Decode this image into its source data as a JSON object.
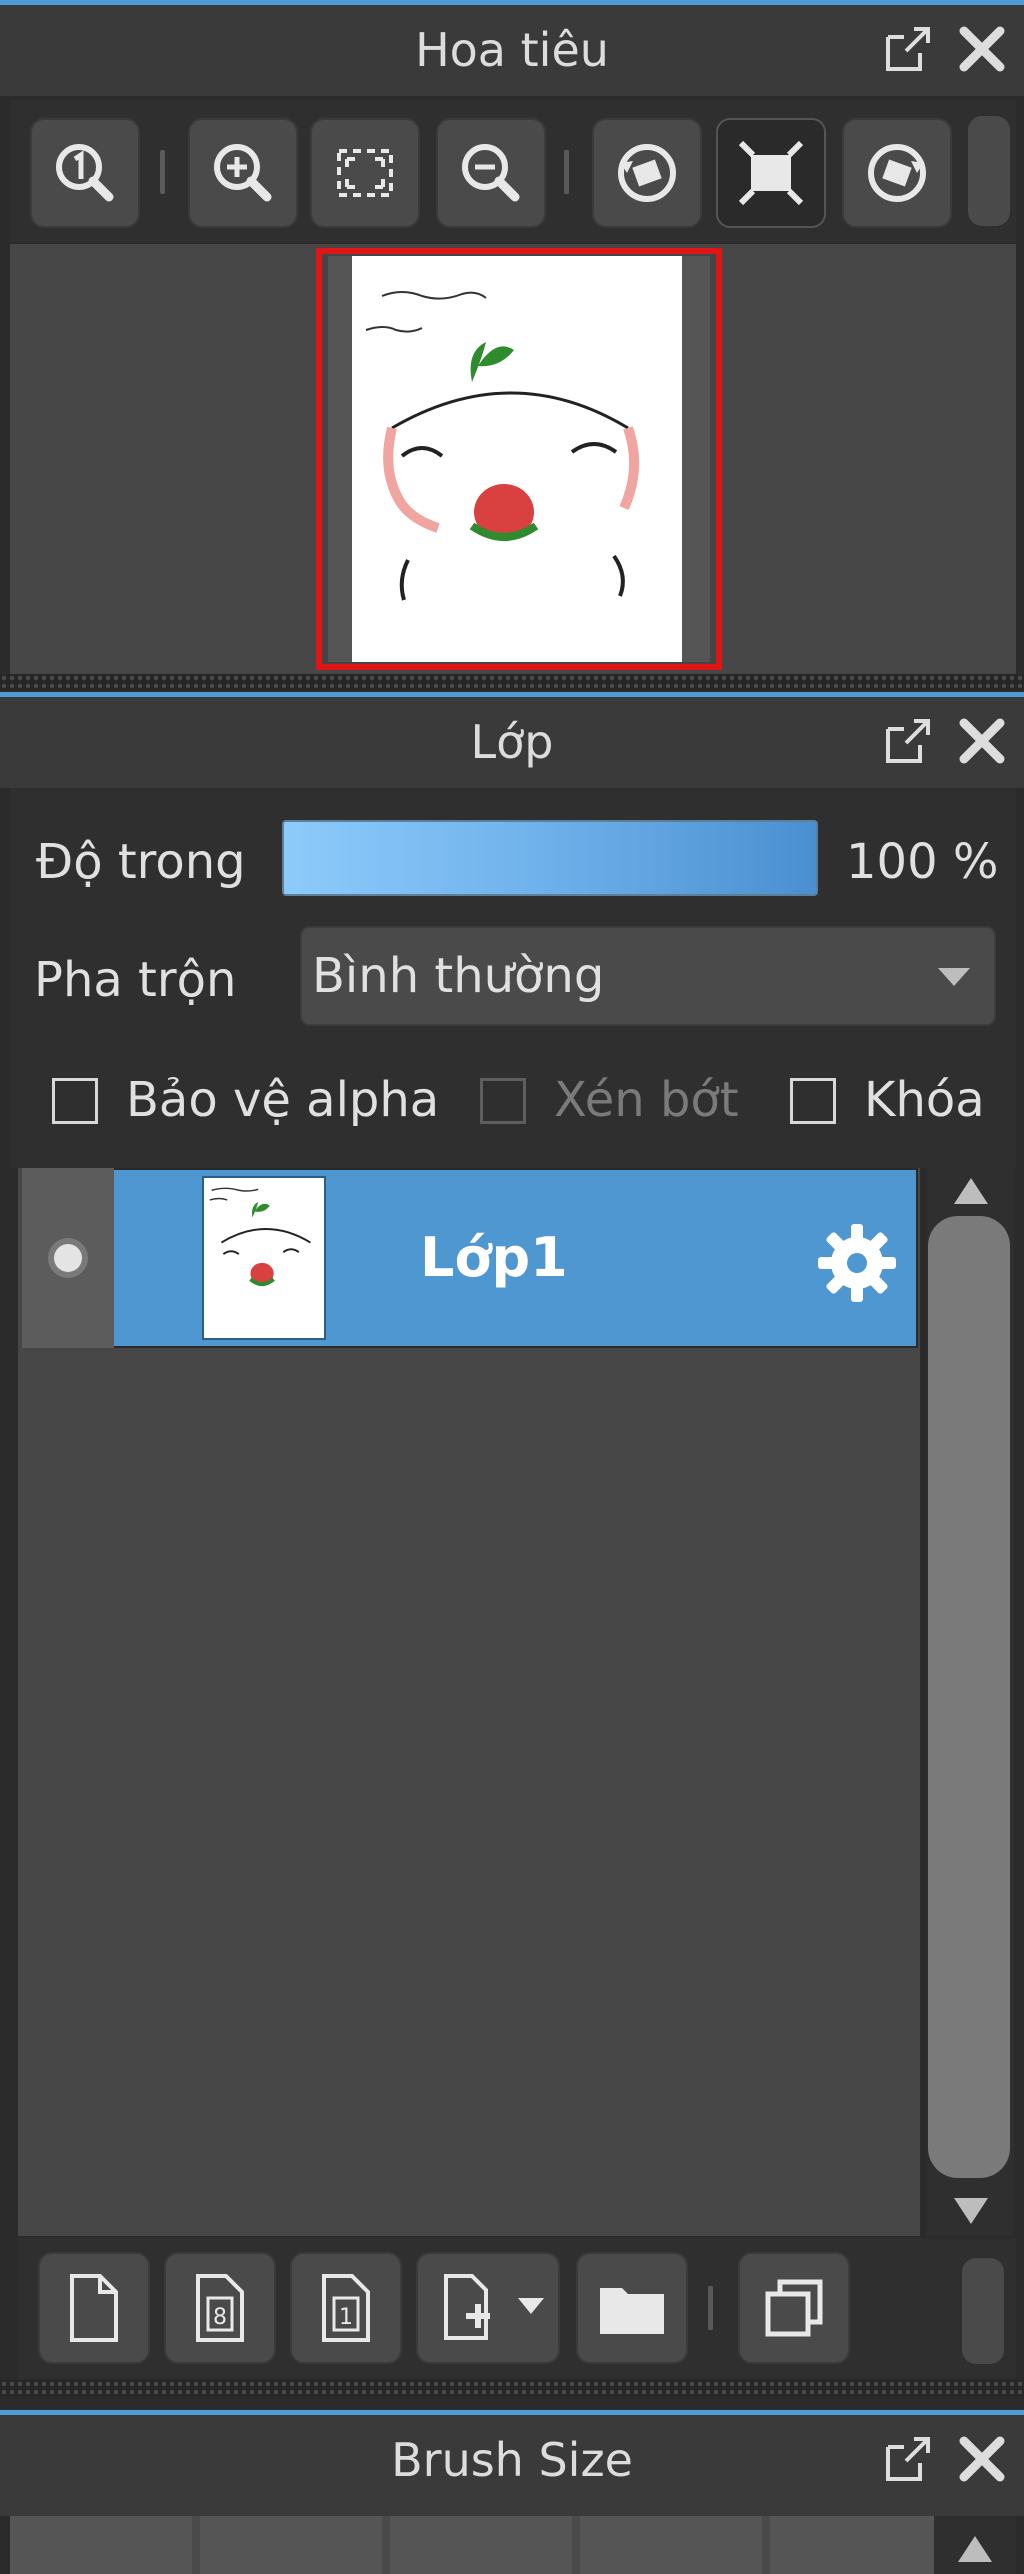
{
  "navigator": {
    "title": "Hoa tiêu",
    "toolbar": [
      {
        "name": "zoom-actual",
        "icon": "zoom-one-icon"
      },
      {
        "name": "zoom-in",
        "icon": "zoom-in-icon"
      },
      {
        "name": "fit-window",
        "icon": "fit-window-icon"
      },
      {
        "name": "zoom-out",
        "icon": "zoom-out-icon"
      },
      {
        "name": "rotate-left",
        "icon": "rotate-left-icon"
      },
      {
        "name": "fit-screen",
        "icon": "fit-screen-icon",
        "selected": true
      },
      {
        "name": "rotate-right",
        "icon": "rotate-right-icon"
      }
    ]
  },
  "layers": {
    "title": "Lớp",
    "opacity_label": "Độ trong",
    "opacity_value": "100 %",
    "opacity_fraction": 1.0,
    "blend_label": "Pha trộn",
    "blend_value": "Bình thường",
    "checkboxes": {
      "protect_alpha": "Bảo vệ alpha",
      "clipping": "Xén bớt",
      "lock": "Khóa"
    },
    "items": [
      {
        "name": "Lớp1",
        "selected": true
      }
    ]
  },
  "brush_size": {
    "title": "Brush Size"
  },
  "colors": {
    "accent": "#4f9bd6",
    "selected_row": "#4e97d0",
    "preview_border": "#e01515"
  }
}
